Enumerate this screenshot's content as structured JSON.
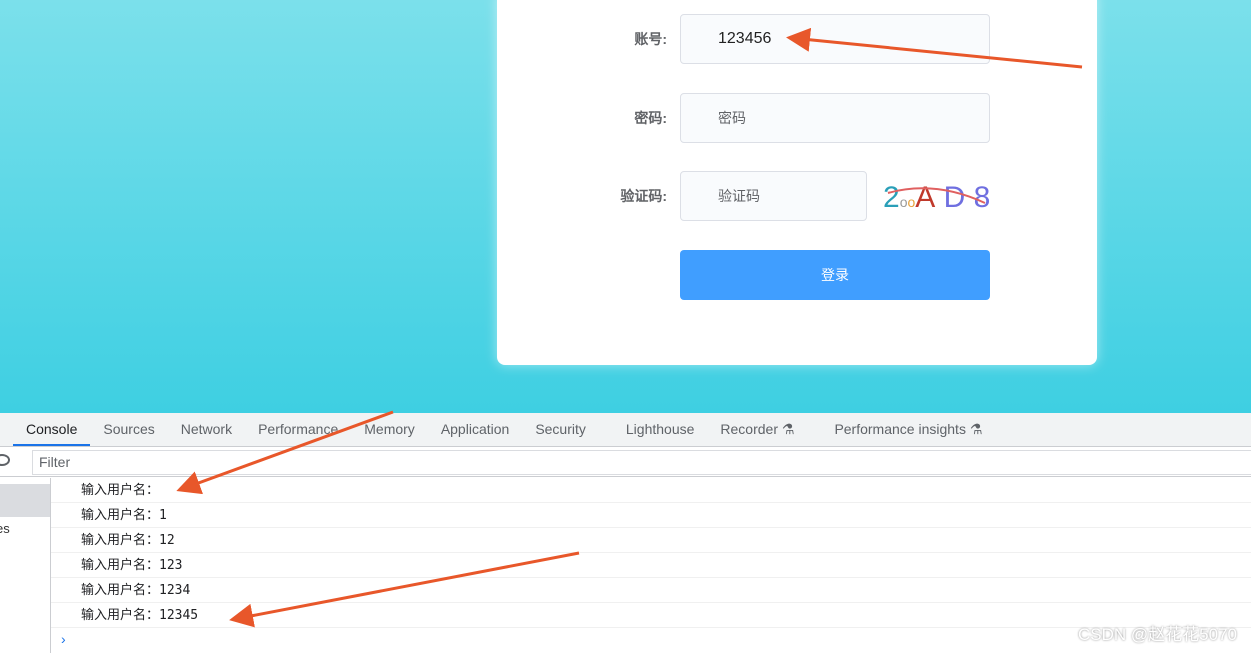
{
  "form": {
    "account_label": "账号:",
    "account_value": "123456",
    "password_label": "密码:",
    "password_placeholder": "密码",
    "captcha_label": "验证码:",
    "captcha_placeholder": "验证码",
    "captcha_chars": [
      "2",
      "o",
      "o",
      "A",
      "D",
      "8"
    ],
    "login_label": "登录"
  },
  "devtools": {
    "tabs": [
      "Console",
      "Sources",
      "Network",
      "Performance",
      "Memory",
      "Application",
      "Security",
      "Lighthouse",
      "Recorder ⚗",
      "Performance insights ⚗"
    ],
    "active_tab": "Console",
    "filter_placeholder": "Filter",
    "sidebar_fragment": "es",
    "logs": [
      "输入用户名：",
      "输入用户名：1",
      "输入用户名：12",
      "输入用户名：123",
      "输入用户名：1234",
      "输入用户名：12345"
    ],
    "prompt": "›"
  },
  "watermark": "CSDN @赵花花5070",
  "colors": {
    "accent": "#409eff",
    "arrow": "#e8572a"
  }
}
